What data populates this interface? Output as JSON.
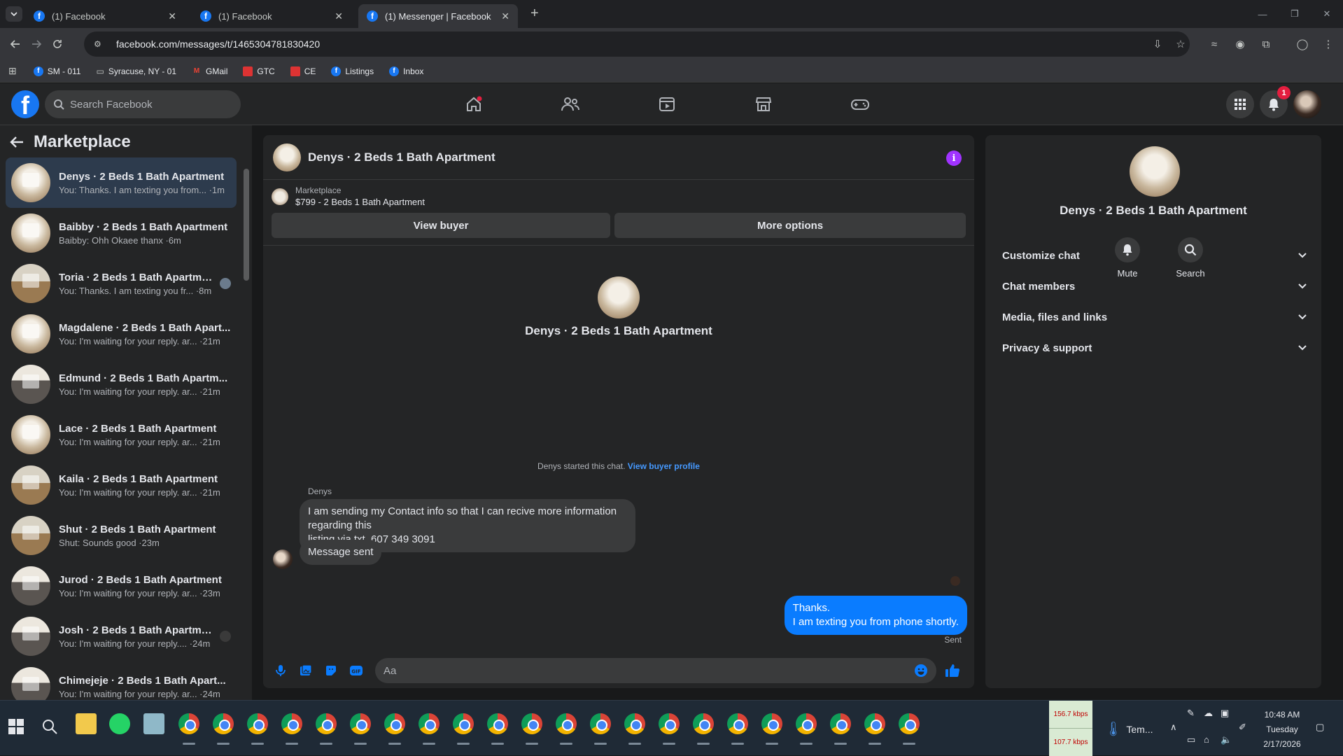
{
  "browser": {
    "tabs": [
      {
        "title": "(1) Facebook"
      },
      {
        "title": "(1) Facebook"
      },
      {
        "title": "(1) Messenger | Facebook"
      }
    ],
    "url": "facebook.com/messages/t/1465304781830420",
    "bookmarks": [
      {
        "label": "SM - 011",
        "icon": "facebook-icon"
      },
      {
        "label": "Syracuse, NY - 01",
        "icon": "folder-icon"
      },
      {
        "label": "GMail",
        "icon": "gmail-icon"
      },
      {
        "label": "GTC",
        "icon": "gtc-icon"
      },
      {
        "label": "CE",
        "icon": "ce-icon"
      },
      {
        "label": "Listings",
        "icon": "facebook-icon"
      },
      {
        "label": "Inbox",
        "icon": "facebook-icon"
      }
    ]
  },
  "facebook": {
    "search_placeholder": "Search Facebook",
    "notifications_count": "1"
  },
  "sidebar": {
    "title": "Marketplace",
    "conversations": [
      {
        "name": "Denys · 2 Beds 1 Bath Apartment",
        "preview": "You: Thanks. I am texting you from... ·1m",
        "active": true
      },
      {
        "name": "Baibby · 2 Beds 1 Bath Apartment",
        "preview": "Baibby: Ohh Okaee thanx ·6m"
      },
      {
        "name": "Toria · 2 Beds 1 Bath Apartment",
        "preview": "You: Thanks. I am texting you fr... ·8m"
      },
      {
        "name": "Magdalene · 2 Beds 1 Bath Apart...",
        "preview": "You: I'm waiting for your reply. ar... ·21m"
      },
      {
        "name": "Edmund · 2 Beds 1 Bath Apartm...",
        "preview": "You: I'm waiting for your reply. ar... ·21m"
      },
      {
        "name": "Lace · 2 Beds 1 Bath Apartment",
        "preview": "You: I'm waiting for your reply. ar... ·21m"
      },
      {
        "name": "Kaila · 2 Beds 1 Bath Apartment",
        "preview": "You: I'm waiting for your reply. ar... ·21m"
      },
      {
        "name": "Shut · 2 Beds 1 Bath Apartment",
        "preview": "Shut: Sounds good ·23m"
      },
      {
        "name": "Jurod · 2 Beds 1 Bath Apartment",
        "preview": "You: I'm waiting for your reply. ar... ·23m"
      },
      {
        "name": "Josh · 2 Beds 1 Bath Apartment",
        "preview": "You: I'm waiting for your reply.... ·24m"
      },
      {
        "name": "Chimejeje · 2 Beds 1 Bath Apart...",
        "preview": "You: I'm waiting for your reply. ar... ·24m"
      }
    ]
  },
  "chat": {
    "title": "Denys · 2 Beds 1 Bath Apartment",
    "listing_source": "Marketplace",
    "listing_price_title": "$799 - 2 Beds 1 Bath Apartment",
    "view_buyer_label": "View buyer",
    "more_options_label": "More options",
    "intro_name": "Denys · 2 Beds 1 Bath Apartment",
    "started_text": "Denys started this chat.",
    "view_profile_link": "View buyer profile",
    "sender_name": "Denys",
    "incoming_message_1": "I am sending my Contact info so that I can recive more information  regarding  this",
    "incoming_message_1b": "listing via txt. 607 349 3091",
    "incoming_message_2": "Message sent",
    "outgoing_line_1": "Thanks.",
    "outgoing_line_2": "I am texting you from phone shortly.",
    "sent_status": "Sent",
    "composer_placeholder": "Aa"
  },
  "info_panel": {
    "name": "Denys · 2 Beds 1 Bath Apartment",
    "mute_label": "Mute",
    "search_label": "Search",
    "sections": [
      "Customize chat",
      "Chat members",
      "Media, files and links",
      "Privacy & support"
    ]
  },
  "taskbar": {
    "net_up": "156.7 kbps",
    "net_down": "107.7 kbps",
    "weather": "Tem...",
    "time": "10:48 AM",
    "day": "Tuesday",
    "date": "2/17/2026"
  },
  "colors": {
    "facebook_blue": "#1877f2",
    "messenger_blue": "#0a7cff",
    "info_purple": "#a033ff",
    "badge_red": "#e41e3f"
  }
}
